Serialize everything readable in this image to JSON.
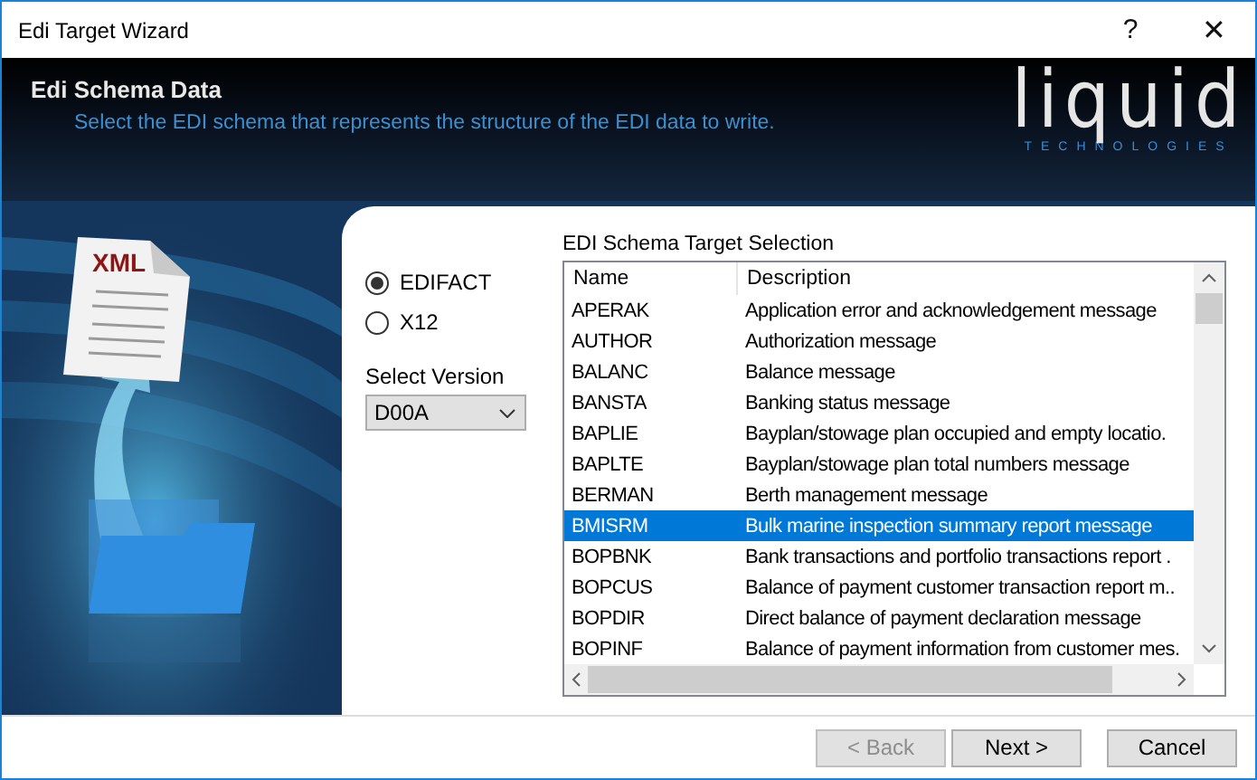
{
  "window": {
    "title": "Edi Target Wizard",
    "help": "?",
    "close": "✕"
  },
  "header": {
    "title": "Edi Schema Data",
    "subtitle": "Select the EDI schema that represents the structure of the EDI data to write.",
    "logo": "liquid",
    "logo_sub": "TECHNOLOGIES"
  },
  "art": {
    "label": "XML"
  },
  "standards": [
    {
      "label": "EDIFACT",
      "selected": true
    },
    {
      "label": "X12",
      "selected": false
    }
  ],
  "version": {
    "label": "Select Version",
    "value": "D00A"
  },
  "schema_list": {
    "title": "EDI Schema Target Selection",
    "columns": [
      "Name",
      "Description"
    ],
    "rows": [
      {
        "name": "APERAK",
        "description": "Application error and acknowledgement message",
        "selected": false
      },
      {
        "name": "AUTHOR",
        "description": "Authorization message",
        "selected": false
      },
      {
        "name": "BALANC",
        "description": "Balance message",
        "selected": false
      },
      {
        "name": "BANSTA",
        "description": "Banking status message",
        "selected": false
      },
      {
        "name": "BAPLIE",
        "description": "Bayplan/stowage plan occupied and empty locatio.",
        "selected": false
      },
      {
        "name": "BAPLTE",
        "description": "Bayplan/stowage plan total numbers message",
        "selected": false
      },
      {
        "name": "BERMAN",
        "description": "Berth management message",
        "selected": false
      },
      {
        "name": "BMISRM",
        "description": "Bulk marine inspection summary report message",
        "selected": true
      },
      {
        "name": "BOPBNK",
        "description": "Bank transactions and portfolio transactions report .",
        "selected": false
      },
      {
        "name": "BOPCUS",
        "description": "Balance of payment customer transaction report m..",
        "selected": false
      },
      {
        "name": "BOPDIR",
        "description": "Direct balance of payment declaration message",
        "selected": false
      },
      {
        "name": "BOPINF",
        "description": "Balance of payment information from customer mes.",
        "selected": false
      }
    ]
  },
  "buttons": [
    {
      "label": "< Back",
      "disabled": true
    },
    {
      "label": "Next >",
      "disabled": false
    },
    {
      "label": "Cancel",
      "disabled": false
    }
  ]
}
